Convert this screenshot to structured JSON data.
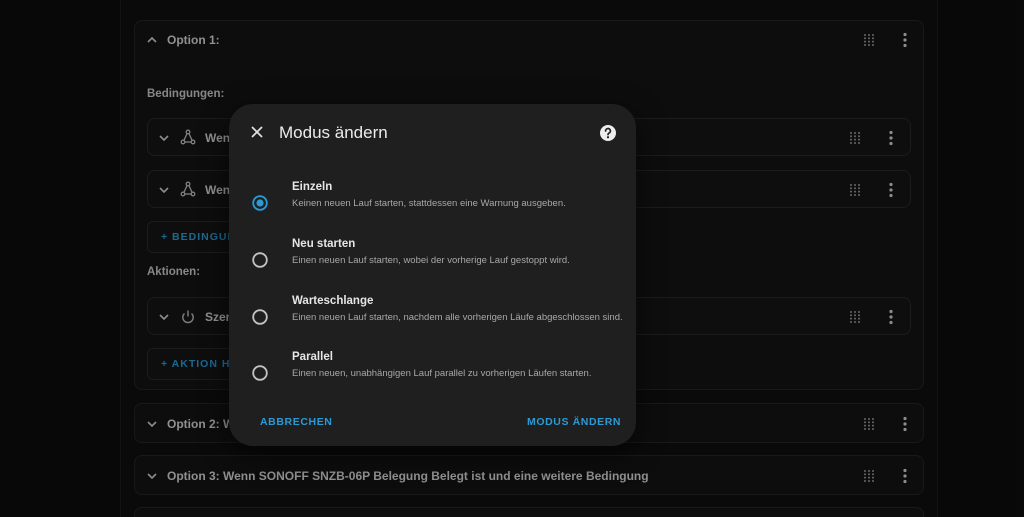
{
  "background_cards": {
    "option1": {
      "title": "Option 1:"
    },
    "conditions_label": "Bedingungen:",
    "condition_items": [
      {
        "label": "Wenn"
      },
      {
        "label": "Wenn"
      }
    ],
    "add_condition_label": "+ BEDINGUN",
    "actions_label": "Aktionen:",
    "action_items": [
      {
        "label": "Szen"
      }
    ],
    "add_action_label": "+ AKTION H",
    "option2": {
      "title": "Option 2: We"
    },
    "option3": {
      "title": "Option 3: Wenn SONOFF SNZB-06P Belegung Belegt ist und eine weitere Bedingung"
    }
  },
  "dialog": {
    "title": "Modus ändern",
    "options": [
      {
        "label": "Einzeln",
        "description": "Keinen neuen Lauf starten, stattdessen eine Warnung ausgeben.",
        "selected": true
      },
      {
        "label": "Neu starten",
        "description": "Einen neuen Lauf starten, wobei der vorherige Lauf gestoppt wird.",
        "selected": false
      },
      {
        "label": "Warteschlange",
        "description": "Einen neuen Lauf starten, nachdem alle vorherigen Läufe abgeschlossen sind.",
        "selected": false
      },
      {
        "label": "Parallel",
        "description": "Einen neuen, unabhängigen Lauf parallel zu vorherigen Läufen starten.",
        "selected": false
      }
    ],
    "cancel_label": "ABBRECHEN",
    "confirm_label": "MODUS ÄNDERN"
  },
  "colors": {
    "accent": "#2a9ad6",
    "dialog_bg": "#1f1f1f",
    "card_bg": "#141414",
    "text_primary": "#e6e6e6",
    "text_secondary": "#a8a8a8"
  },
  "icons": {
    "close": "close-icon",
    "help": "help-circle-icon",
    "chevron_up": "chevron-up-icon",
    "chevron_down": "chevron-down-icon",
    "drag": "drag-handle-icon",
    "menu": "dots-vertical-icon",
    "state_trigger": "state-node-icon",
    "power": "power-icon"
  }
}
